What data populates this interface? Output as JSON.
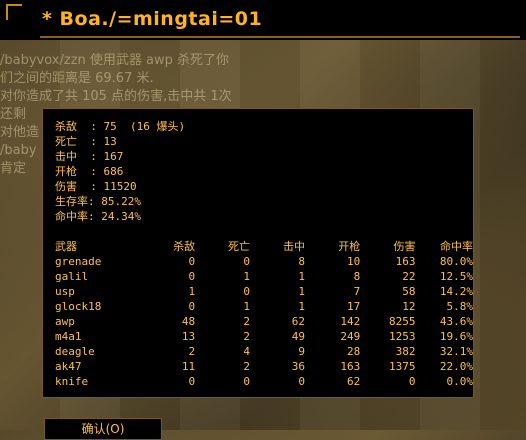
{
  "title": "* Boa./=mingtai=01",
  "chat": [
    "/babyvox/zzn 使用武器 awp 杀死了你",
    "们之间的距离是 69.67 米.",
    "对你造成了共 105 点的伤害,击中共 1次",
    "还剩",
    "对他造",
    "/baby",
    "肯定"
  ],
  "summary": [
    {
      "label": "杀敌  ",
      "value": ": 75  (16 爆头)"
    },
    {
      "label": "死亡  ",
      "value": ": 13"
    },
    {
      "label": "击中  ",
      "value": ": 167"
    },
    {
      "label": "开枪  ",
      "value": ": 686"
    },
    {
      "label": "伤害  ",
      "value": ": 11520"
    },
    {
      "label": "生存率",
      "value": ": 85.22%"
    },
    {
      "label": "命中率",
      "value": ": 24.34%"
    }
  ],
  "table": {
    "headers": [
      "武器",
      "杀敌",
      "死亡",
      "击中",
      "开枪",
      "伤害",
      "命中率"
    ],
    "rows": [
      [
        "grenade",
        "0",
        "0",
        "8",
        "10",
        "163",
        "80.0%"
      ],
      [
        "galil",
        "0",
        "1",
        "1",
        "8",
        "22",
        "12.5%"
      ],
      [
        "usp",
        "1",
        "0",
        "1",
        "7",
        "58",
        "14.2%"
      ],
      [
        "glock18",
        "0",
        "1",
        "1",
        "17",
        "12",
        "5.8%"
      ],
      [
        "awp",
        "48",
        "2",
        "62",
        "142",
        "8255",
        "43.6%"
      ],
      [
        "m4a1",
        "13",
        "2",
        "49",
        "249",
        "1253",
        "19.6%"
      ],
      [
        "deagle",
        "2",
        "4",
        "9",
        "28",
        "382",
        "32.1%"
      ],
      [
        "ak47",
        "11",
        "2",
        "36",
        "163",
        "1375",
        "22.0%"
      ],
      [
        "knife",
        "0",
        "0",
        "0",
        "62",
        "0",
        "0.0%"
      ]
    ]
  },
  "ok_label": "确认(O)",
  "colors": {
    "text": "#ffc040",
    "title": "#ffb41a",
    "border": "#7a5a18"
  }
}
